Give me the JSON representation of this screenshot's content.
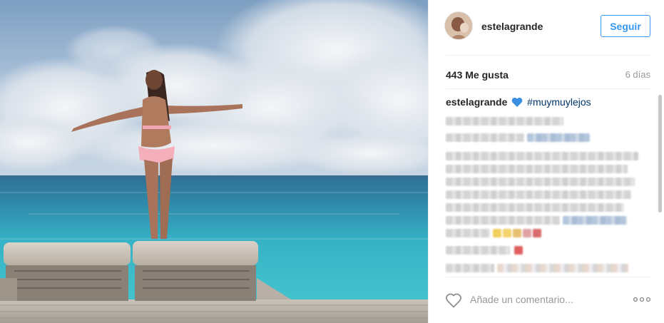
{
  "post": {
    "username": "estelagrande",
    "follow_label": "Seguir",
    "likes_label": "443 Me gusta",
    "time_label": "6 días"
  },
  "caption": {
    "author": "estelagrande",
    "emoji": "blue-heart-icon",
    "hashtag": "#muymuylejos"
  },
  "comment_box": {
    "placeholder": "Añade un comentario..."
  },
  "icons": {
    "like": "heart-outline-icon",
    "more": "ellipsis-icon"
  },
  "colors": {
    "accent": "#3897f0",
    "hashtag": "#003569",
    "muted": "#999999",
    "text": "#262626"
  }
}
